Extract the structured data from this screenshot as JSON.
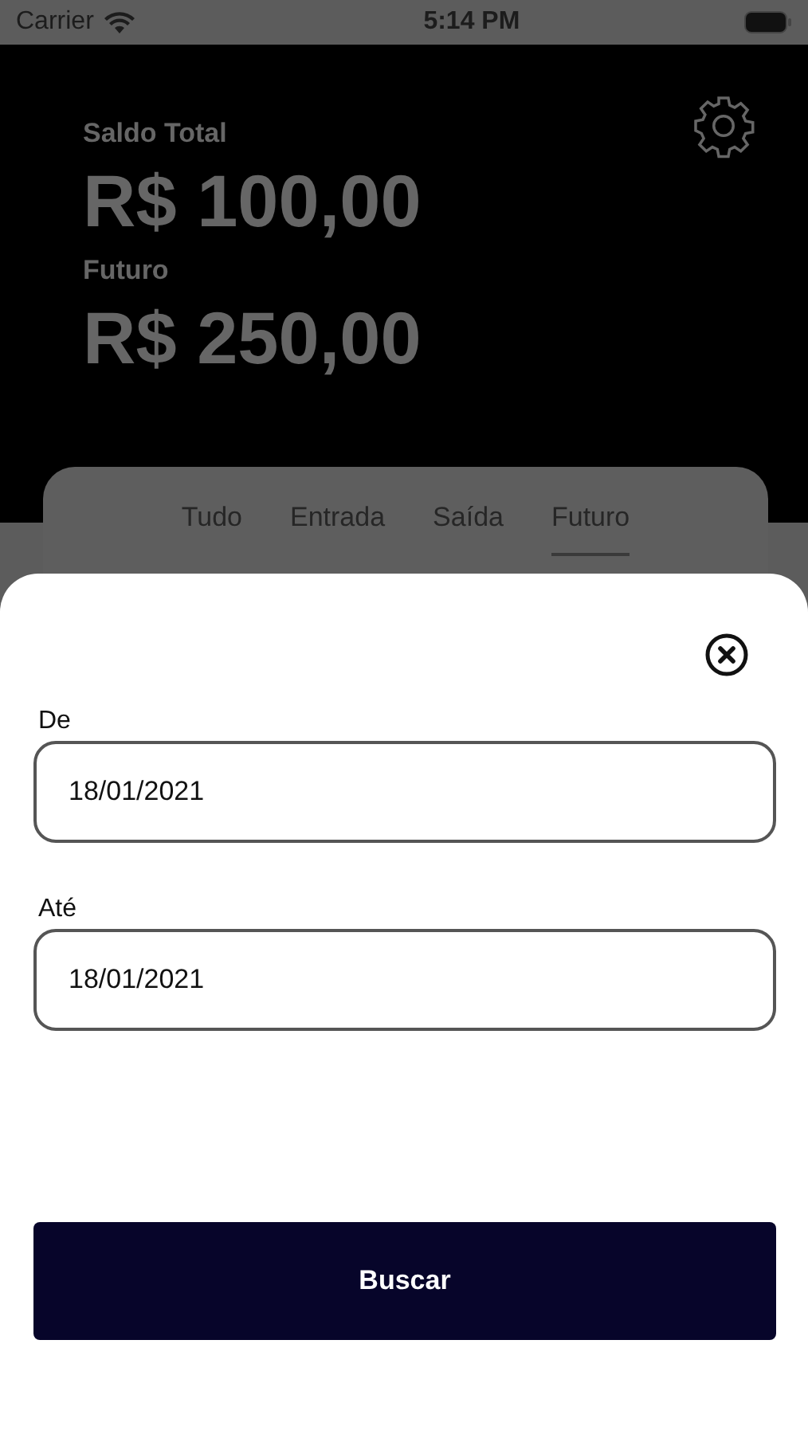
{
  "status_bar": {
    "carrier": "Carrier",
    "time": "5:14 PM"
  },
  "header": {
    "balance_label": "Saldo Total",
    "balance": "R$ 100,00",
    "future_label": "Futuro",
    "future": "R$ 250,00"
  },
  "tabs": [
    {
      "label": "Tudo",
      "selected": false
    },
    {
      "label": "Entrada",
      "selected": false
    },
    {
      "label": "Saída",
      "selected": false
    },
    {
      "label": "Futuro",
      "selected": true
    }
  ],
  "filter_sheet": {
    "fields": [
      {
        "label": "De",
        "value": "18/01/2021"
      },
      {
        "label": "Até",
        "value": "18/01/2021"
      }
    ],
    "button": "Buscar"
  }
}
